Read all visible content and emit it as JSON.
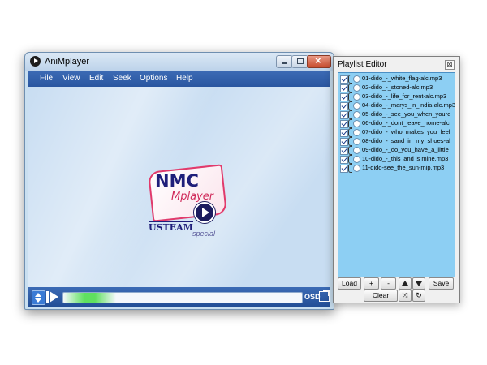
{
  "player": {
    "title": "AniMplayer",
    "menu": [
      "File",
      "View",
      "Edit",
      "Seek",
      "Options",
      "Help"
    ],
    "logo": {
      "line1": "NMC",
      "line2": "Mplayer",
      "line3": "USTEAM",
      "line4": "special"
    },
    "osd_label": "OSD",
    "seek_progress": 0.22
  },
  "playlist": {
    "title": "Playlist Editor",
    "close_glyph": "⊠",
    "tracks": [
      "01-dido_-_white_flag-alc.mp3",
      "02-dido_-_stoned-alc.mp3",
      "03-dido_-_life_for_rent-alc.mp3",
      "04-dido_-_marys_in_india-alc.mp3",
      "05-dido_-_see_you_when_youre",
      "06-dido_-_dont_leave_home-alc",
      "07-dido_-_who_makes_you_feel",
      "08-dido_-_sand_in_my_shoes-al",
      "09-dido_-_do_you_have_a_little",
      "10-dido_-_this land is mine.mp3",
      "11-dido-see_the_sun-mip.mp3"
    ],
    "buttons": {
      "load": "Load",
      "add": "+",
      "remove": "-",
      "save": "Save",
      "clear": "Clear"
    }
  }
}
